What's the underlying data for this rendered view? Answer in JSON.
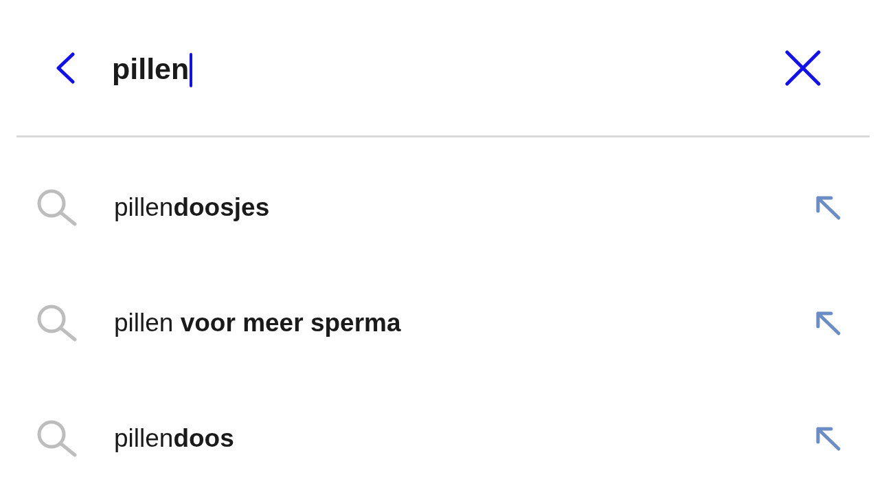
{
  "search_bar": {
    "value": "pillen",
    "focused": true
  },
  "suggestions": [
    {
      "text": "pillen**doosjes**"
    },
    {
      "text": "pillen **voor meer sperma**"
    },
    {
      "text": "pillen**doos**"
    }
  ]
}
